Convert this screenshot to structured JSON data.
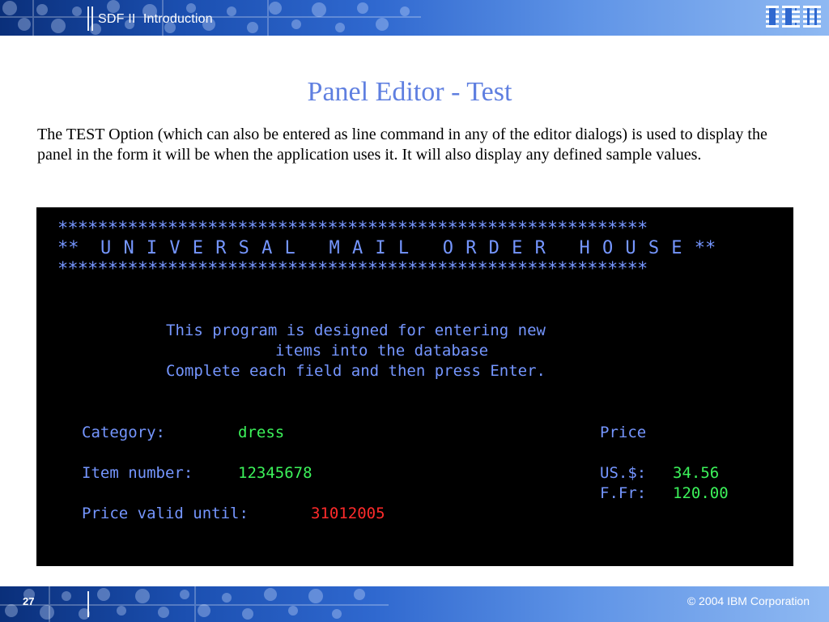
{
  "header": {
    "title": "SDF II  Introduction",
    "logo": "IBM"
  },
  "slide": {
    "title": "Panel Editor - Test",
    "body": "The TEST Option (which can also be entered as line command in any of the editor dialogs) is used to display the panel in the form it will be when the application uses it. It will also display any defined sample values."
  },
  "terminal": {
    "stars": "***********************************************************",
    "banner_left": "**",
    "banner_text": "UNIVERSAL",
    "banner_mid1": "MAIL",
    "banner_mid2": "ORDER",
    "banner_mid3": "HOUSE",
    "banner_right": "**",
    "intro_line1": "This program is designed for entering new",
    "intro_line2": "items into the database",
    "intro_line3": "Complete each field and then press Enter.",
    "category_label": "Category:",
    "category_value": "dress",
    "price_label": "Price",
    "item_label": "Item number:",
    "item_value": "12345678",
    "us_label": "US.$:",
    "us_value": "34.56",
    "ffr_label": "F.Fr:",
    "ffr_value": "120.00",
    "valid_label": "Price valid until:",
    "valid_value": "31012005"
  },
  "footer": {
    "page_number": "27",
    "copyright": "© 2004 IBM Corporation"
  },
  "colors": {
    "terminal_label": "#7596ff",
    "terminal_value": "#3cf25a",
    "terminal_date": "#ff2b2b",
    "title": "#5f7fe0"
  }
}
